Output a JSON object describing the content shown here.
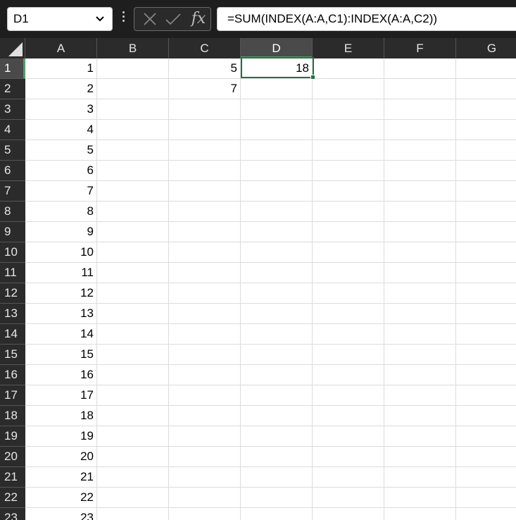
{
  "formula_bar": {
    "name_box": "D1",
    "chevron_icon": "chevron-down-icon",
    "more_icon": "vertical-dots-icon",
    "cancel_icon": "close-icon",
    "confirm_icon": "check-icon",
    "fx_label": "fx",
    "formula": "=SUM(INDEX(A:A,C1):INDEX(A:A,C2))"
  },
  "columns": [
    "A",
    "B",
    "C",
    "D",
    "E",
    "F",
    "G"
  ],
  "active_column": "D",
  "active_row": "1",
  "rows": [
    {
      "header": "1",
      "cells": [
        "1",
        "",
        "5",
        "18",
        "",
        "",
        ""
      ]
    },
    {
      "header": "2",
      "cells": [
        "2",
        "",
        "7",
        "",
        "",
        "",
        ""
      ]
    },
    {
      "header": "3",
      "cells": [
        "3",
        "",
        "",
        "",
        "",
        "",
        ""
      ]
    },
    {
      "header": "4",
      "cells": [
        "4",
        "",
        "",
        "",
        "",
        "",
        ""
      ]
    },
    {
      "header": "5",
      "cells": [
        "5",
        "",
        "",
        "",
        "",
        "",
        ""
      ]
    },
    {
      "header": "6",
      "cells": [
        "6",
        "",
        "",
        "",
        "",
        "",
        ""
      ]
    },
    {
      "header": "7",
      "cells": [
        "7",
        "",
        "",
        "",
        "",
        "",
        ""
      ]
    },
    {
      "header": "8",
      "cells": [
        "8",
        "",
        "",
        "",
        "",
        "",
        ""
      ]
    },
    {
      "header": "9",
      "cells": [
        "9",
        "",
        "",
        "",
        "",
        "",
        ""
      ]
    },
    {
      "header": "10",
      "cells": [
        "10",
        "",
        "",
        "",
        "",
        "",
        ""
      ]
    },
    {
      "header": "11",
      "cells": [
        "11",
        "",
        "",
        "",
        "",
        "",
        ""
      ]
    },
    {
      "header": "12",
      "cells": [
        "12",
        "",
        "",
        "",
        "",
        "",
        ""
      ]
    },
    {
      "header": "13",
      "cells": [
        "13",
        "",
        "",
        "",
        "",
        "",
        ""
      ]
    },
    {
      "header": "14",
      "cells": [
        "14",
        "",
        "",
        "",
        "",
        "",
        ""
      ]
    },
    {
      "header": "15",
      "cells": [
        "15",
        "",
        "",
        "",
        "",
        "",
        ""
      ]
    },
    {
      "header": "16",
      "cells": [
        "16",
        "",
        "",
        "",
        "",
        "",
        ""
      ]
    },
    {
      "header": "17",
      "cells": [
        "17",
        "",
        "",
        "",
        "",
        "",
        ""
      ]
    },
    {
      "header": "18",
      "cells": [
        "18",
        "",
        "",
        "",
        "",
        "",
        ""
      ]
    },
    {
      "header": "19",
      "cells": [
        "19",
        "",
        "",
        "",
        "",
        "",
        ""
      ]
    },
    {
      "header": "20",
      "cells": [
        "20",
        "",
        "",
        "",
        "",
        "",
        ""
      ]
    },
    {
      "header": "21",
      "cells": [
        "21",
        "",
        "",
        "",
        "",
        "",
        ""
      ]
    },
    {
      "header": "22",
      "cells": [
        "22",
        "",
        "",
        "",
        "",
        "",
        ""
      ]
    },
    {
      "header": "23",
      "cells": [
        "23",
        "",
        "",
        "",
        "",
        "",
        ""
      ]
    }
  ],
  "colors": {
    "toolbar_bg": "#1e1e1e",
    "header_bg": "#2b2b2b",
    "active_header_bg": "#4a4a4a",
    "selection_border": "#217346",
    "gridline": "#dcdcdc"
  }
}
